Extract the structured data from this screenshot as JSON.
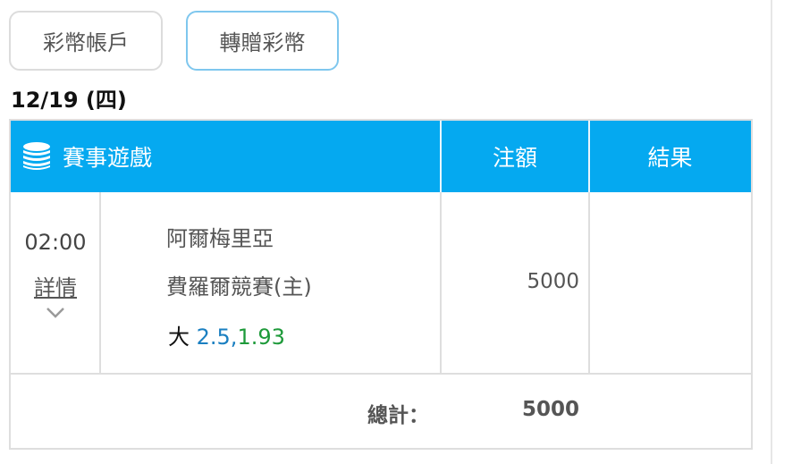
{
  "tabs": {
    "account_label": "彩幣帳戶",
    "transfer_label": "轉贈彩幣"
  },
  "date": "12/19 (四)",
  "table": {
    "header": {
      "game_label": "賽事遊戲",
      "stake_label": "注額",
      "result_label": "結果"
    },
    "rows": [
      {
        "time": "02:00",
        "detail_link": "詳情",
        "team_line1": "阿爾梅里亞",
        "team_line2": "費羅爾競賽(主)",
        "bet_word": "大",
        "bet_handicap": "2.5,",
        "bet_odds": "1.93",
        "stake": "5000",
        "result": ""
      }
    ],
    "total_label": "總計：",
    "total_value": "5000"
  },
  "colors": {
    "header_bg": "#05a9f0",
    "handicap": "#1a7fc1",
    "odds": "#1e9a3a"
  },
  "icons": {
    "game_header_icon": "coin-stack-icon",
    "expand_icon": "chevron-down-icon"
  }
}
